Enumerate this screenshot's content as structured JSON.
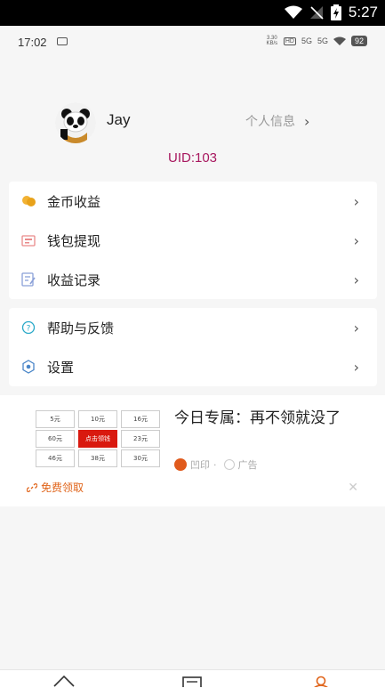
{
  "system_status": {
    "time": "5:27"
  },
  "inner_status": {
    "time": "17:02",
    "net_speed": "3.30 KB/s",
    "hd": "HD",
    "sim1": "5G",
    "sim2": "5G",
    "battery": "92"
  },
  "profile": {
    "username": "Jay",
    "info_link": "个人信息",
    "uid": "UID:103"
  },
  "menu_group1": [
    {
      "label": "金币收益",
      "icon": "coins-icon"
    },
    {
      "label": "钱包提现",
      "icon": "wallet-icon"
    },
    {
      "label": "收益记录",
      "icon": "records-icon"
    }
  ],
  "menu_group2": [
    {
      "label": "帮助与反馈",
      "icon": "help-icon"
    },
    {
      "label": "设置",
      "icon": "settings-icon"
    }
  ],
  "ad": {
    "grid": [
      "5元",
      "10元",
      "16元",
      "60元",
      "点击领钱",
      "23元",
      "46元",
      "38元",
      "30元"
    ],
    "title": "今日专属：再不领就没了",
    "brand": "凹印",
    "tag": "广告",
    "cta": "免费领取"
  },
  "colors": {
    "uid": "#a8185f",
    "cta": "#e0641a",
    "hot_cell": "#d9190f"
  }
}
